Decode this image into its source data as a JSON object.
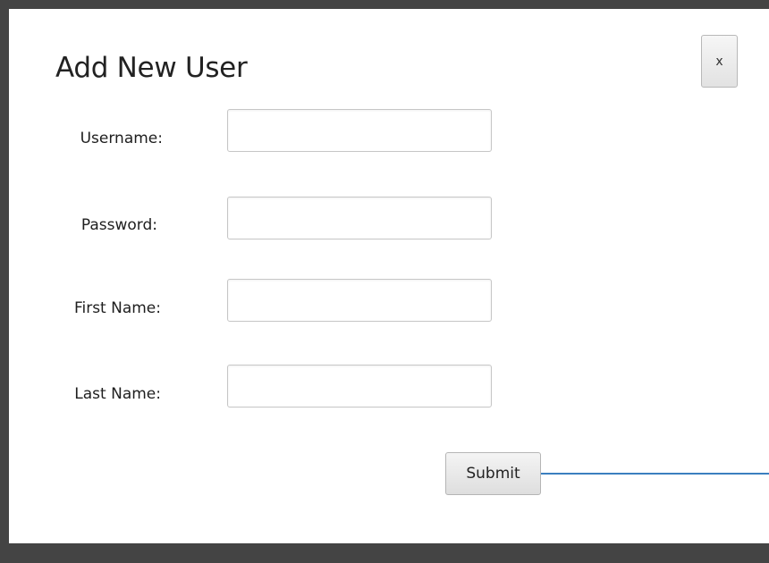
{
  "dialog": {
    "title": "Add New User",
    "close_label": "x",
    "fields": [
      {
        "label": "Username:",
        "value": "",
        "placeholder": ""
      },
      {
        "label": "Password:",
        "value": "",
        "placeholder": ""
      },
      {
        "label": "First Name:",
        "value": "",
        "placeholder": ""
      },
      {
        "label": "Last Name:",
        "value": "",
        "placeholder": ""
      }
    ],
    "submit_label": "Submit"
  },
  "colors": {
    "frame": "#444444",
    "connector_line": "#3b7fbf"
  }
}
